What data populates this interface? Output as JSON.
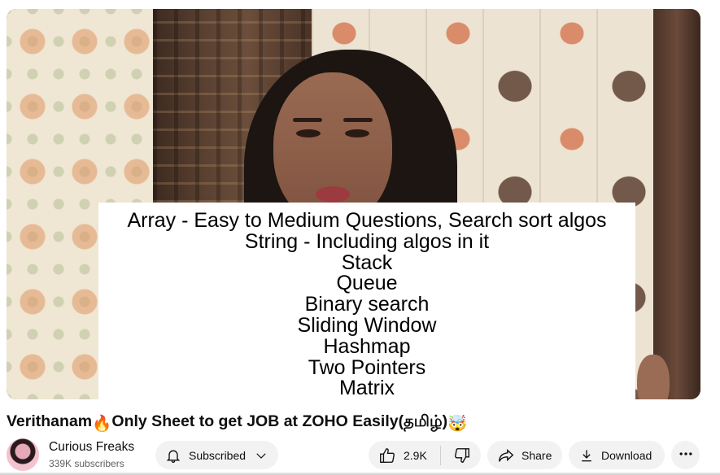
{
  "video": {
    "overlay_lines": [
      "Array - Easy to Medium Questions, Search sort algos",
      "String - Including algos in it",
      "Stack",
      "Queue",
      "Binary search",
      "Sliding Window",
      "Hashmap",
      "Two Pointers",
      "Matrix"
    ]
  },
  "title": {
    "part1": "Verithanam",
    "emoji1": "🔥",
    "part2": "Only Sheet to get JOB at ZOHO Easily(தமிழ்)",
    "emoji2": "🤯"
  },
  "channel": {
    "name": "Curious Freaks",
    "subscribers": "339K subscribers"
  },
  "actions": {
    "subscribed_label": "Subscribed",
    "likes": "2.9K",
    "share_label": "Share",
    "download_label": "Download"
  },
  "icons": {
    "bell": "bell-icon",
    "chevron": "chevron-down-icon",
    "like": "thumbs-up-icon",
    "dislike": "thumbs-down-icon",
    "share": "share-arrow-icon",
    "download": "download-icon",
    "more": "more-horizontal-icon"
  }
}
